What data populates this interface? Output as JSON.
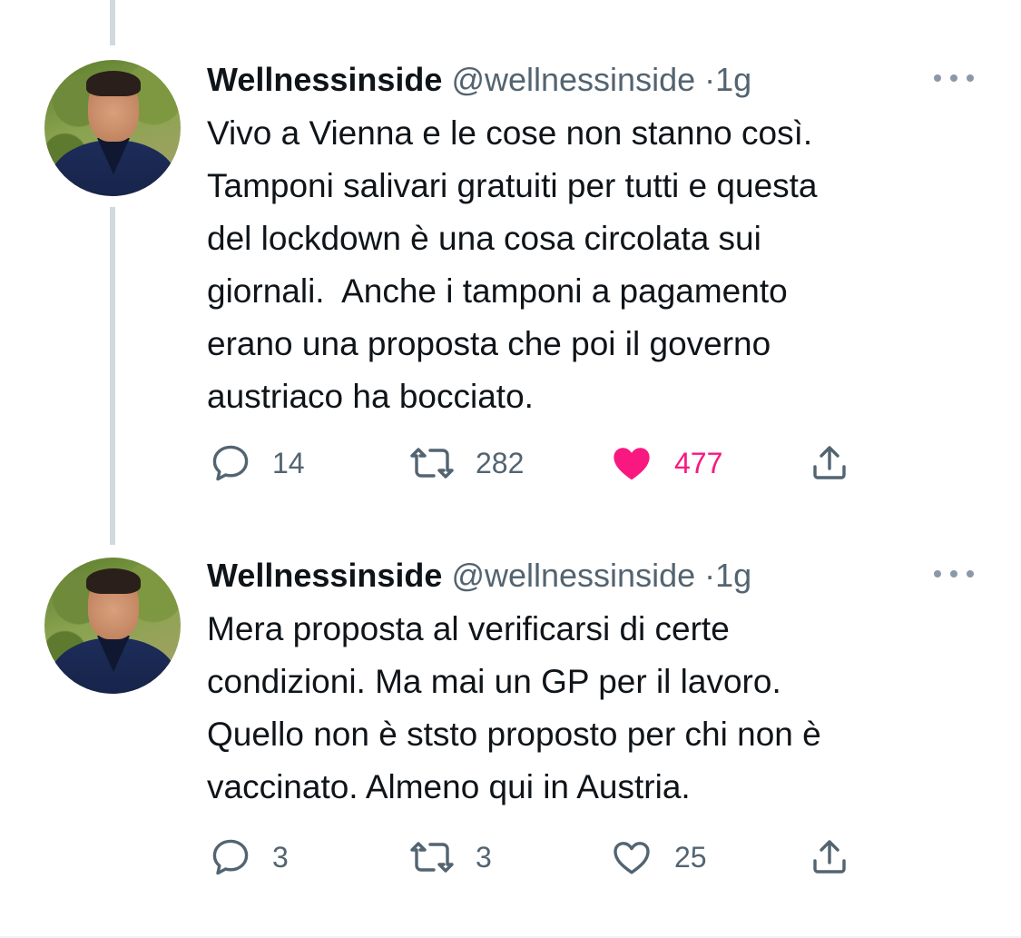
{
  "colors": {
    "text": "#0f1419",
    "muted": "#536471",
    "like_active": "#f91880",
    "thread_line": "#cfd9de"
  },
  "tweets": [
    {
      "author": {
        "name": "Wellnessinside",
        "handle": "@wellnessinside",
        "separator": "·",
        "time": "1g"
      },
      "text": "Vivo a Vienna e le cose non stanno così.\nTamponi salivari gratuiti per tutti e questa\ndel lockdown è una cosa circolata sui\ngiornali.  Anche i tamponi a pagamento\nerano una proposta che poi il governo\naustriaco ha bocciato.",
      "actions": {
        "reply_count": "14",
        "retweet_count": "282",
        "like_count": "477",
        "liked": true
      },
      "icons": [
        "reply-icon",
        "retweet-icon",
        "heart-icon",
        "share-icon",
        "more-icon"
      ]
    },
    {
      "author": {
        "name": "Wellnessinside",
        "handle": "@wellnessinside",
        "separator": "·",
        "time": "1g"
      },
      "text": "Mera proposta al verificarsi di certe\ncondizioni. Ma mai un GP per il lavoro.\nQuello non è ststo proposto per chi non è\nvaccinato. Almeno qui in Austria.",
      "actions": {
        "reply_count": "3",
        "retweet_count": "3",
        "like_count": "25",
        "liked": false
      },
      "icons": [
        "reply-icon",
        "retweet-icon",
        "heart-icon",
        "share-icon",
        "more-icon"
      ]
    }
  ]
}
